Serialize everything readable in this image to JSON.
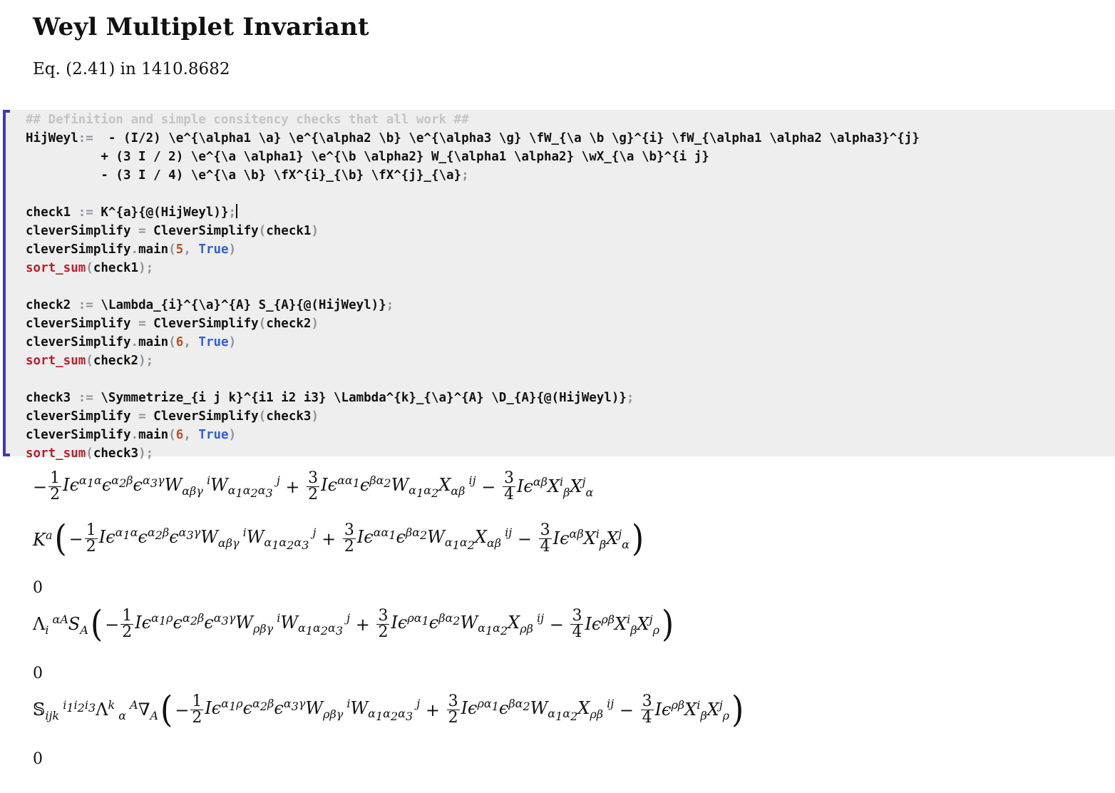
{
  "header": {
    "title": "Weyl Multiplet Invariant",
    "subtitle": "Eq. (2.41) in 1410.8682"
  },
  "code_cell": {
    "comment": "## Definition and simple consitency checks that all work ##",
    "def_name": "HijWeyl",
    "def_op": ":=",
    "def_line1": "  - (I/2) \\e^{\\alpha1 \\a} \\e^{\\alpha2 \\b} \\e^{\\alpha3 \\g} \\fW_{\\a \\b \\g}^{i} \\fW_{\\alpha1 \\alpha2 \\alpha3}^{j}",
    "def_line2": "          + (3 I / 2) \\e^{\\a \\alpha1} \\e^{\\b \\alpha2} W_{\\alpha1 \\alpha2} \\wX_{\\a \\b}^{i j}",
    "def_line3": "          - (3 I / 4) \\e^{\\a \\b} \\fX^{i}_{\\b} \\fX^{j}_{\\a}",
    "semicolon": ";",
    "checks": [
      {
        "name": "check1",
        "expr": "K^{a}{@(HijWeyl)}",
        "var": "cleverSimplify",
        "cls": "CleverSimplify",
        "method": "main",
        "depth": "5",
        "flag": "True",
        "sort_fn": "sort_sum"
      },
      {
        "name": "check2",
        "expr": "\\Lambda_{i}^{\\a}^{A} S_{A}{@(HijWeyl)}",
        "var": "cleverSimplify",
        "cls": "CleverSimplify",
        "method": "main",
        "depth": "6",
        "flag": "True",
        "sort_fn": "sort_sum"
      },
      {
        "name": "check3",
        "expr": "\\Symmetrize_{i j k}^{i1 i2 i3} \\Lambda^{k}_{\\a}^{A} \\D_{A}{@(HijWeyl)}",
        "var": "cleverSimplify",
        "cls": "CleverSimplify",
        "method": "main",
        "depth": "6",
        "flag": "True",
        "sort_fn": "sort_sum"
      }
    ]
  },
  "outputs": {
    "zero": "0",
    "minus_half": "1",
    "two": "2",
    "three": "3",
    "four": "4"
  },
  "colors": {
    "bracket": "#3b3ab8",
    "cell_bg": "#eeeeee",
    "comment": "#c4c4c4",
    "number": "#b5532a",
    "keyword": "#2f5fd8",
    "function": "#b8202a",
    "operator": "#8b949c"
  }
}
